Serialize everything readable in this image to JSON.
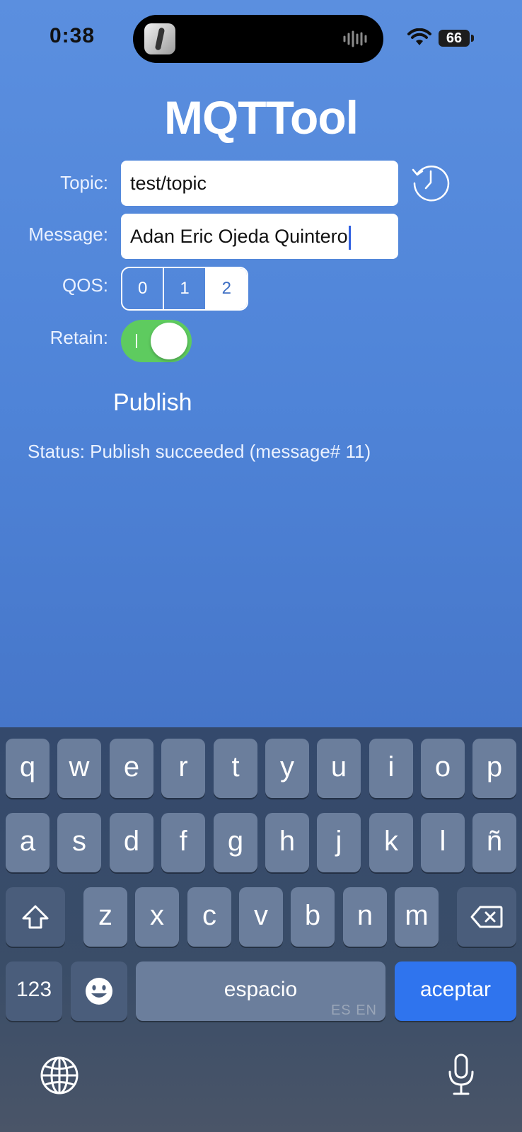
{
  "status_bar": {
    "time": "0:38",
    "battery": "66"
  },
  "app": {
    "title": "MQTTool"
  },
  "form": {
    "topic_label": "Topic:",
    "topic_value": "test/topic",
    "message_label": "Message:",
    "message_value": "Adan Eric Ojeda Quintero",
    "qos_label": "QOS:",
    "qos_options": [
      "0",
      "1",
      "2"
    ],
    "qos_selected": "2",
    "retain_label": "Retain:",
    "retain_on": true
  },
  "actions": {
    "publish_label": "Publish"
  },
  "status": {
    "text": "Status: Publish succeeded (message# 11)"
  },
  "keyboard": {
    "row1": [
      "q",
      "w",
      "e",
      "r",
      "t",
      "y",
      "u",
      "i",
      "o",
      "p"
    ],
    "row2": [
      "a",
      "s",
      "d",
      "f",
      "g",
      "h",
      "j",
      "k",
      "l",
      "ñ"
    ],
    "row3": [
      "z",
      "x",
      "c",
      "v",
      "b",
      "n",
      "m"
    ],
    "numbers_label": "123",
    "space_label": "espacio",
    "language_hint": "ES EN",
    "return_label": "aceptar"
  },
  "colors": {
    "background": "#4f84d8",
    "toggle_on": "#5ecb5f",
    "return_key": "#2f74ee",
    "caret": "#2f5fe0"
  },
  "icons": [
    "history-icon",
    "wifi-icon",
    "battery-icon",
    "shift-icon",
    "backspace-icon",
    "emoji-icon",
    "globe-icon",
    "microphone-icon"
  ]
}
